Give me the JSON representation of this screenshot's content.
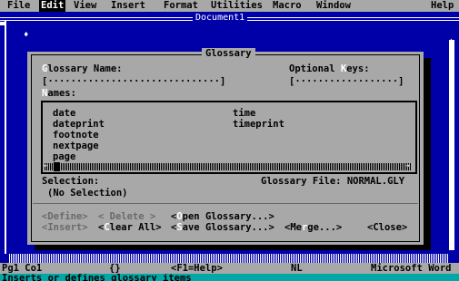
{
  "menubar": {
    "items": [
      "File",
      "Edit",
      "View",
      "Insert",
      "Format",
      "Utilities",
      "Macro",
      "Window"
    ],
    "help": "Help",
    "active": "Edit"
  },
  "document": {
    "title": "Document1"
  },
  "dialog": {
    "title": "Glossary",
    "glossary_name_label": "lossary Name:",
    "glossary_name_hotkey": "G",
    "glossary_name_field": "[······························]",
    "optional_keys_label_a": "Optional ",
    "optional_keys_hotkey": "K",
    "optional_keys_label_b": "eys:",
    "optional_keys_field": "[··················]",
    "names_hotkey": "N",
    "names_label": "ames:",
    "names_col1": [
      "date",
      "dateprint",
      "footnote",
      "nextpage",
      "page"
    ],
    "names_col2": [
      "time",
      "timeprint"
    ],
    "selection_label": "Selection:",
    "selection_value": "(No Selection)",
    "glossary_file_label": "Glossary File: NORMAL.GLY",
    "buttons": {
      "define": "<Define>",
      "delete": "< Delete >",
      "open_a": "<",
      "open_hotkey": "O",
      "open_b": "pen Glossary...>",
      "insert": "<Insert>",
      "clear_a": "<",
      "clear_hotkey": "C",
      "clear_b": "lear All>",
      "save_a": "<",
      "save_hotkey": "S",
      "save_b": "ave Glossary...>",
      "merge_a": "<Me",
      "merge_hotkey": "r",
      "merge_b": "ge...>",
      "close": "<Close>"
    }
  },
  "statusbar": {
    "page": "Pg1 Co1",
    "braces": "{}",
    "help_hint": "<F1=Help>",
    "mode": "NL",
    "app": "Microsoft Word"
  },
  "hint": "Inserts or defines glossary items"
}
